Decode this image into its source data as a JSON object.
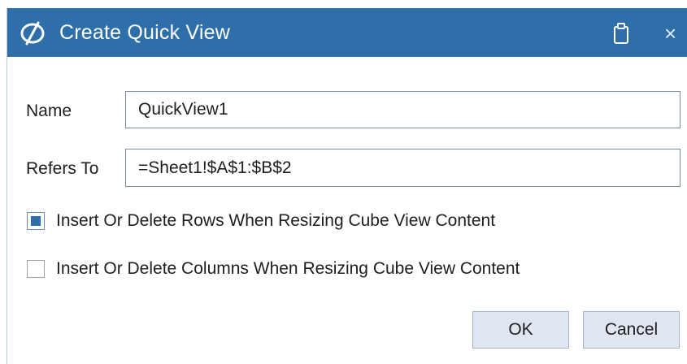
{
  "dialog": {
    "title": "Create Quick View",
    "icons": {
      "logo": "app-logo-icon",
      "clipboard": "clipboard-icon",
      "close": "close-icon"
    },
    "close_glyph": "×",
    "accent_color": "#2e6faa"
  },
  "form": {
    "name_label": "Name",
    "name_value": "QuickView1",
    "refers_label": "Refers To",
    "refers_value": "=Sheet1!$A$1:$B$2"
  },
  "options": [
    {
      "label": "Insert Or Delete Rows When Resizing Cube View Content",
      "checked": true
    },
    {
      "label": "Insert Or Delete Columns When Resizing Cube View Content",
      "checked": false
    }
  ],
  "buttons": {
    "ok": "OK",
    "cancel": "Cancel"
  }
}
